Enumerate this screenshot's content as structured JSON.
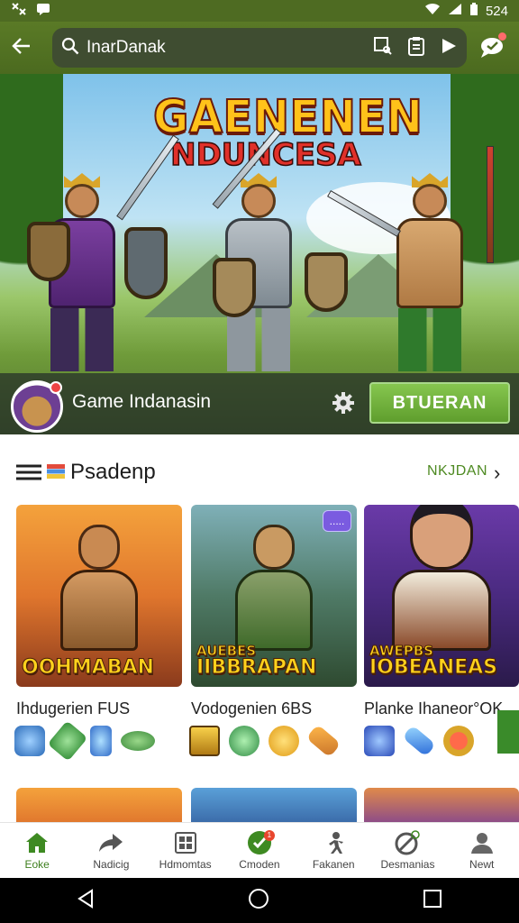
{
  "status_bar": {
    "time": "524",
    "icons": [
      "tools-icon",
      "message-icon",
      "wifi-icon",
      "signal-icon",
      "battery-icon"
    ]
  },
  "app_bar": {
    "search_query": "InarDanak",
    "icons": [
      "back-icon",
      "search-icon",
      "screen-search-icon",
      "clipboard-icon",
      "play-icon",
      "chat-icon"
    ]
  },
  "featured": {
    "title_line1": "GAENENEN",
    "title_line2": "NDUNCESA",
    "game_name": "Game Indanasin",
    "install_label": "BTUERAN",
    "colors": {
      "title": "#ffc21a",
      "title2": "#e0312a",
      "install": "#6fb23a"
    }
  },
  "section": {
    "title": "Psadenp",
    "more_label": "NKJDAN"
  },
  "cards": [
    {
      "label_line1": "",
      "label_line2": "OOHMABAN",
      "title": "Ihdugerien FUS"
    },
    {
      "label_line1": "AUEBES",
      "label_line2": "IIBBRAPAN",
      "title": "Vodogenien 6BS",
      "more_label": "....."
    },
    {
      "label_line1": "AWEPBS",
      "label_line2": "IOBEANEAS",
      "title": "Planke Ihaneor°OK"
    }
  ],
  "item_rows": [
    [
      "dice-icon",
      "wrench-icon",
      "potion-icon",
      "leaf-icon",
      "scroll-icon"
    ],
    [
      "chest-icon",
      "orb-icon",
      "axe-icon"
    ],
    [
      "gem-icon",
      "battery-item-icon",
      "medal-icon"
    ]
  ],
  "bottom_nav": [
    {
      "label": "Eoke",
      "icon": "home-icon",
      "active": true
    },
    {
      "label": "Nadicig",
      "icon": "share-icon"
    },
    {
      "label": "Hdmomtas",
      "icon": "grid-icon"
    },
    {
      "label": "Cmoden",
      "icon": "check-badge-icon",
      "badge": "1"
    },
    {
      "label": "Fakanen",
      "icon": "runner-icon"
    },
    {
      "label": "Desmanias",
      "icon": "no-entry-icon"
    },
    {
      "label": "Newt",
      "icon": "person-icon"
    }
  ],
  "system_nav": [
    "back-triangle-icon",
    "home-circle-icon",
    "recents-square-icon"
  ]
}
